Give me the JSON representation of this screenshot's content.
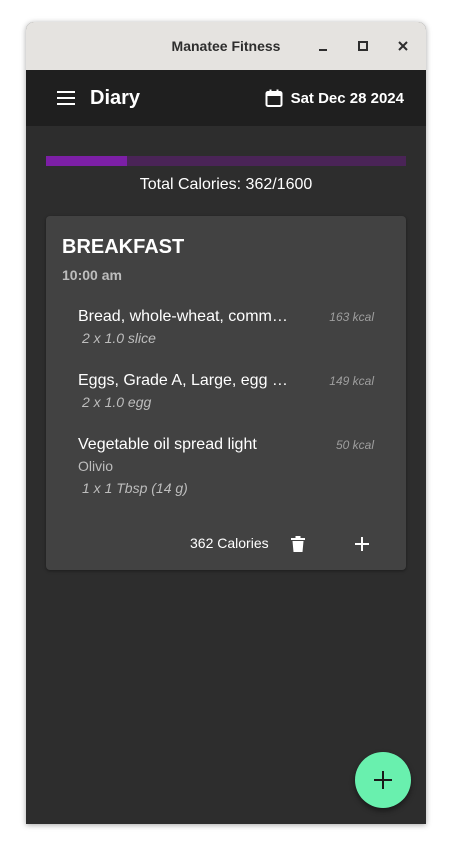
{
  "window": {
    "title": "Manatee Fitness"
  },
  "appbar": {
    "title": "Diary",
    "date": "Sat Dec 28 2024"
  },
  "summary": {
    "total_calories_text": "Total Calories: 362/1600",
    "consumed": 362,
    "goal": 1600
  },
  "meal": {
    "name": "BREAKFAST",
    "time": "10:00 am",
    "entries": [
      {
        "name": "Bread, whole-wheat, commercially prepared",
        "kcal": "163 kcal",
        "brand": "",
        "quantity": "2 x 1.0 slice"
      },
      {
        "name": "Eggs, Grade A, Large, egg whole",
        "kcal": "149 kcal",
        "brand": "",
        "quantity": "2 x 1.0 egg"
      },
      {
        "name": "Vegetable oil spread light",
        "kcal": "50 kcal",
        "brand": "Olivio",
        "quantity": "1 x 1 Tbsp (14 g)"
      }
    ],
    "footer_calories": "362 Calories"
  },
  "colors": {
    "accent": "#7c1fa6",
    "fab": "#69f0ae",
    "background": "#2d2d2d",
    "card": "#424242"
  },
  "icons": {
    "menu": "menu-icon",
    "calendar": "calendar-icon",
    "delete": "trash-icon",
    "add": "plus-icon",
    "fab": "plus-icon"
  }
}
